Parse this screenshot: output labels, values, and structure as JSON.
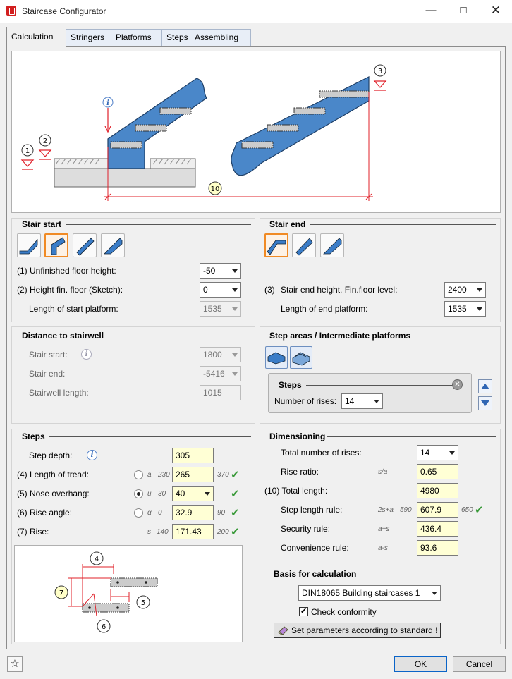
{
  "window": {
    "title": "Staircase Configurator"
  },
  "tabs": [
    "Calculation",
    "Stringers",
    "Platforms",
    "Steps",
    "Assembling"
  ],
  "illustration": {
    "markers": [
      "1",
      "2",
      "3",
      "10"
    ]
  },
  "stair_start": {
    "title": "Stair start",
    "unfinished_floor_label": "(1) Unfinished floor height:",
    "unfinished_floor_value": "-50",
    "height_fin_floor_label": "(2) Height fin. floor  (Sketch):",
    "height_fin_floor_value": "0",
    "length_start_platform_label": "Length of start platform:",
    "length_start_platform_value": "1535"
  },
  "stair_end": {
    "title": "Stair end",
    "num": "(3)",
    "end_height_label": "Stair end height, Fin.floor level:",
    "end_height_value": "2400",
    "length_end_platform_label": "Length of end platform:",
    "length_end_platform_value": "1535"
  },
  "distance": {
    "title": "Distance to stairwell",
    "stair_start_label": "Stair start:",
    "stair_start_value": "1800",
    "stair_end_label": "Stair end:",
    "stair_end_value": "-5416",
    "stairwell_length_label": "Stairwell length:",
    "stairwell_length_value": "1015"
  },
  "step_areas": {
    "title": "Step areas / Intermediate platforms",
    "steps_title": "Steps",
    "rises_label": "Number of rises:",
    "rises_value": "14"
  },
  "steps": {
    "title": "Steps",
    "step_depth_label": "Step depth:",
    "step_depth_value": "305",
    "tread_label": "(4) Length of tread:",
    "tread_sym": "a",
    "tread_min": "230",
    "tread_value": "265",
    "tread_max": "370",
    "nose_label": "(5) Nose overhang:",
    "nose_sym": "u",
    "nose_min": "30",
    "nose_value": "40",
    "angle_label": "(6) Rise angle:",
    "angle_sym": "α",
    "angle_min": "0",
    "angle_value": "32.9",
    "angle_max": "90",
    "rise_label": "(7) Rise:",
    "rise_sym": "s",
    "rise_min": "140",
    "rise_value": "171.43",
    "rise_max": "200",
    "diagram_markers": [
      "4",
      "7",
      "5",
      "6"
    ]
  },
  "dimensioning": {
    "title": "Dimensioning",
    "total_rises_label": "Total number of rises:",
    "total_rises_value": "14",
    "rise_ratio_label": "Rise ratio:",
    "rise_ratio_formula": "s/a",
    "rise_ratio_value": "0.65",
    "total_length_label": "(10) Total length:",
    "total_length_value": "4980",
    "step_rule_label": "Step length rule:",
    "step_rule_formula": "2s+a",
    "step_rule_min": "590",
    "step_rule_value": "607.9",
    "step_rule_max": "650",
    "security_label": "Security rule:",
    "security_formula": "a+s",
    "security_value": "436.4",
    "convenience_label": "Convenience rule:",
    "convenience_formula": "a-s",
    "convenience_value": "93.6",
    "basis_label": "Basis for calculation",
    "basis_value": "DIN18065 Building staircases 1",
    "check_label": "Check conformity",
    "set_params_label": "Set parameters according to standard !"
  },
  "footer": {
    "ok": "OK",
    "cancel": "Cancel"
  },
  "colors": {
    "stringer": "#4a87c9",
    "dimension": "#e0202a",
    "input_bg": "#ffffd5",
    "selected": "#f08a24"
  }
}
